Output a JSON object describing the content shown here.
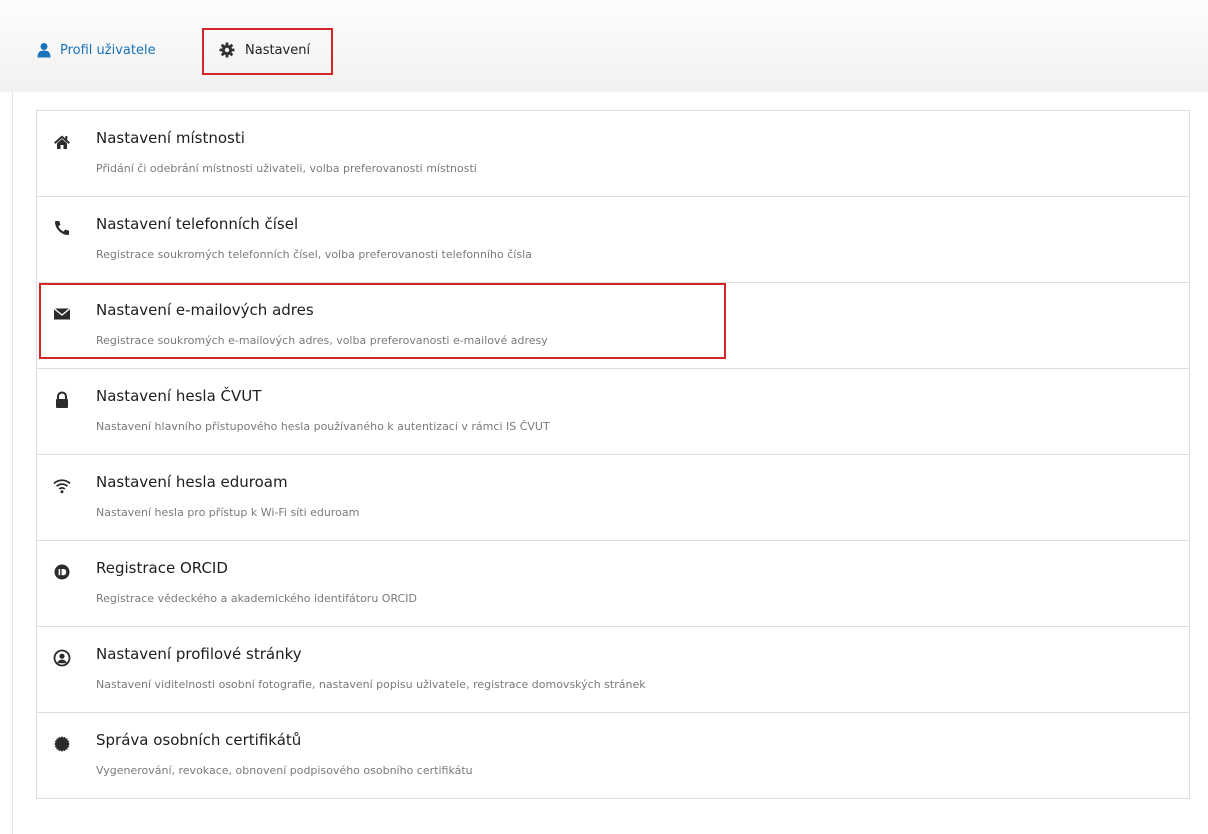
{
  "tabs": [
    {
      "label": "Profil uživatele",
      "icon": "user-icon"
    },
    {
      "label": "Nastavení",
      "icon": "gear-icon"
    }
  ],
  "accent_color": "#1a73b8",
  "highlight_color": "#d42626",
  "settings": [
    {
      "title": "Nastavení místnosti",
      "description": "Přidání či odebrání místnosti uživateli, volba preferovanosti místnosti",
      "icon": "home-icon"
    },
    {
      "title": "Nastavení telefonních čísel",
      "description": "Registrace soukromých telefonních čísel, volba preferovanosti telefonního čísla",
      "icon": "phone-icon"
    },
    {
      "title": "Nastavení e-mailových adres",
      "description": "Registrace soukromých e-mailových adres, volba preferovanosti e-mailové adresy",
      "icon": "envelope-icon"
    },
    {
      "title": "Nastavení hesla ČVUT",
      "description": "Nastavení hlavního přístupového hesla používaného k autentizaci v rámci IS ČVUT",
      "icon": "lock-icon"
    },
    {
      "title": "Nastavení hesla eduroam",
      "description": "Nastavení hesla pro přístup k Wi-Fi síti eduroam",
      "icon": "wifi-icon"
    },
    {
      "title": "Registrace ORCID",
      "description": "Registrace vědeckého a akademického identifátoru ORCID",
      "icon": "orcid-icon"
    },
    {
      "title": "Nastavení profilové stránky",
      "description": "Nastavení viditelnosti osobní fotografie, nastavení popisu uživatele, registrace domovských stránek",
      "icon": "user-circle-icon"
    },
    {
      "title": "Správa osobních certifikátů",
      "description": "Vygenerování, revokace, obnovení podpisového osobního certifikátu",
      "icon": "certificate-icon"
    }
  ]
}
